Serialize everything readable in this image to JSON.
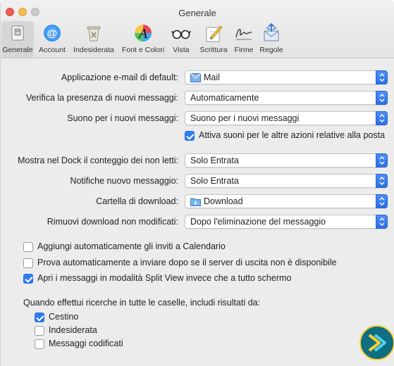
{
  "window": {
    "title": "Generale"
  },
  "toolbar": {
    "items": [
      {
        "label": "Generale",
        "icon": "general-switch-icon",
        "selected": true
      },
      {
        "label": "Account",
        "icon": "at-sign-icon",
        "selected": false
      },
      {
        "label": "Indesiderata",
        "icon": "junk-trash-icon",
        "selected": false
      },
      {
        "label": "Font e Colori",
        "icon": "font-colors-icon",
        "selected": false
      },
      {
        "label": "Vista",
        "icon": "glasses-icon",
        "selected": false
      },
      {
        "label": "Scrittura",
        "icon": "pencil-paper-icon",
        "selected": false
      },
      {
        "label": "Firme",
        "icon": "signature-icon",
        "selected": false
      },
      {
        "label": "Regole",
        "icon": "rules-envelope-icon",
        "selected": false
      }
    ]
  },
  "settings": {
    "default_mail_label": "Applicazione e-mail di default:",
    "default_mail_value": "Mail",
    "check_new_label": "Verifica la presenza di nuovi messaggi:",
    "check_new_value": "Automaticamente",
    "sound_label": "Suono per i nuovi messaggi:",
    "sound_value": "Suono per i nuovi messaggi",
    "other_sounds_label": "Attiva suoni per le altre azioni relative alla posta",
    "dock_count_label": "Mostra nel Dock il conteggio dei non letti:",
    "dock_count_value": "Solo Entrata",
    "notifications_label": "Notifiche nuovo messaggio:",
    "notifications_value": "Solo Entrata",
    "download_folder_label": "Cartella di download:",
    "download_folder_value": "Download",
    "remove_downloads_label": "Rimuovi download non modificati:",
    "remove_downloads_value": "Dopo l'eliminazione del messaggio"
  },
  "options": {
    "add_invites_label": "Aggiungi automaticamente gli inviti a Calendario",
    "retry_send_label": "Prova automaticamente a inviare dopo se il server di uscita non è disponibile",
    "split_view_label": "Apri i messaggi in modalità Split View invece che a tutto schermo"
  },
  "search": {
    "heading": "Quando effettui ricerche in tutte le caselle, includi risultati da:",
    "trash_label": "Cestino",
    "junk_label": "Indesiderata",
    "encrypted_label": "Messaggi codificati"
  },
  "checkbox_states": {
    "other_sounds": true,
    "add_invites": false,
    "retry_send": false,
    "split_view": true,
    "trash": true,
    "junk": false,
    "encrypted": false
  },
  "colors": {
    "accent": "#2f7bf5",
    "window_bg": "#ececec"
  }
}
